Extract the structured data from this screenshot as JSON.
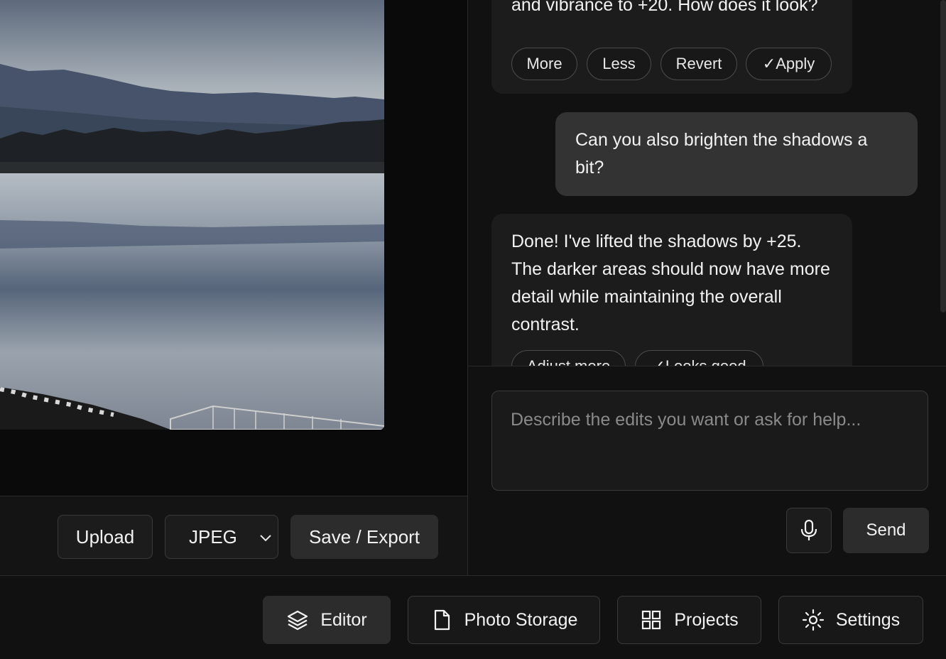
{
  "chat": {
    "ai_msg_1_text": "and vibrance to +20. How does it look?",
    "ai_msg_1_chips": [
      "More",
      "Less",
      "Revert",
      "✓Apply"
    ],
    "user_msg_text": "Can you also brighten the shadows a bit?",
    "ai_msg_2_text": "Done! I've lifted the shadows by +25. The darker areas should now have more detail while maintaining the overall contrast.",
    "ai_msg_2_chips": [
      "Adjust more",
      "✓Looks good"
    ]
  },
  "composer": {
    "placeholder": "Describe the edits you want or ask for help...",
    "send_label": "Send"
  },
  "toolbar": {
    "upload_label": "Upload",
    "format_value": "JPEG",
    "save_label": "Save / Export"
  },
  "nav": {
    "editor": "Editor",
    "photo_storage": "Photo Storage",
    "projects": "Projects",
    "settings": "Settings"
  },
  "icons": {
    "mic": "mic-icon",
    "layers": "layers-icon",
    "file": "file-icon",
    "grid": "grid-icon",
    "sun": "sun-icon",
    "chevron": "chevron-down-icon"
  },
  "colors": {
    "background": "#0a0a0a",
    "panel": "#111111",
    "bubble_ai": "#1c1c1c",
    "bubble_user": "#333333",
    "active_button": "#2c2c2c"
  }
}
